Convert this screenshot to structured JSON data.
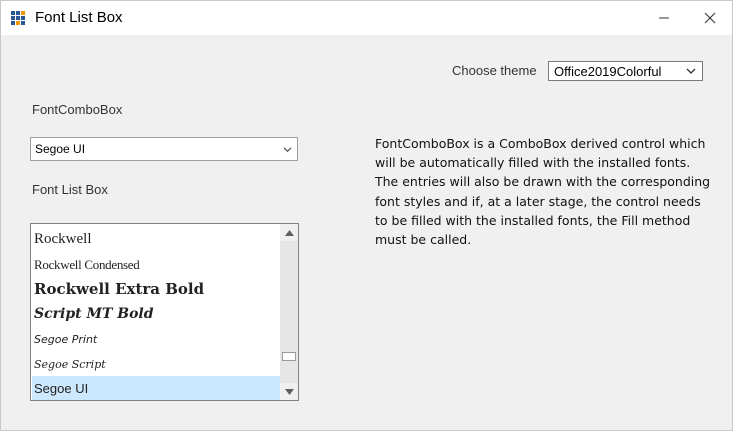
{
  "window": {
    "title": "Font List Box",
    "minimize_symbol": "—",
    "close_symbol": "✕"
  },
  "theme": {
    "label": "Choose theme",
    "selected": "Office2019Colorful"
  },
  "font_combo": {
    "label": "FontComboBox",
    "selected": "Segoe UI"
  },
  "font_list": {
    "label": "Font List Box",
    "items": [
      "Rockwell",
      "Rockwell Condensed",
      "Rockwell Extra Bold",
      "Script MT Bold",
      "Segoe Print",
      "Segoe Script",
      "Segoe UI"
    ],
    "selected_index": 6
  },
  "description": "FontComboBox is a ComboBox derived control which will be automatically filled with the installed fonts. The entries will also be drawn with the corresponding font styles and if, at a later stage, the control needs to be filled with the installed fonts, the Fill method must be called.",
  "icons": {
    "app": "app-grid-icon",
    "dropdown": "chevron-down-icon"
  },
  "colors": {
    "selection": "#cce8ff",
    "app_icon_blue": "#2b5797",
    "app_icon_orange": "#f09609"
  }
}
